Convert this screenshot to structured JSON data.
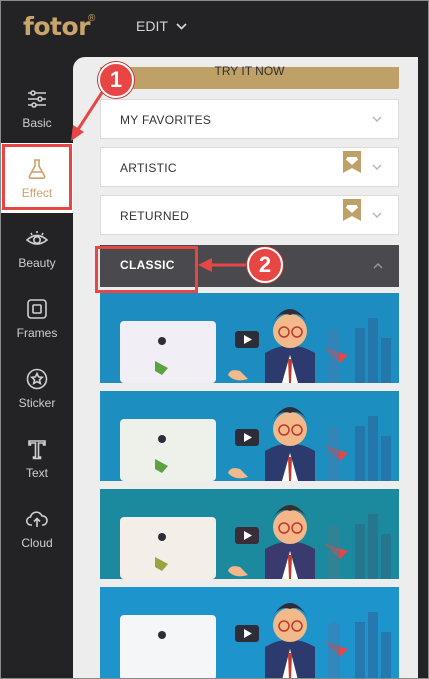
{
  "app": {
    "logo": "fotor",
    "logo_mark": "®",
    "menu_label": "EDIT"
  },
  "sidebar": {
    "items": [
      {
        "label": "Basic",
        "icon": "sliders-icon"
      },
      {
        "label": "Effect",
        "icon": "flask-icon",
        "active": true
      },
      {
        "label": "Beauty",
        "icon": "eye-icon"
      },
      {
        "label": "Frames",
        "icon": "frame-icon"
      },
      {
        "label": "Sticker",
        "icon": "star-badge-icon"
      },
      {
        "label": "Text",
        "icon": "text-t-icon"
      },
      {
        "label": "Cloud",
        "icon": "cloud-upload-icon"
      }
    ]
  },
  "panel": {
    "try_button": "TRY IT NOW",
    "categories": [
      {
        "name": "MY FAVORITES",
        "premium": false,
        "expanded": false
      },
      {
        "name": "ARTISTIC",
        "premium": true,
        "expanded": false
      },
      {
        "name": "RETURNED",
        "premium": true,
        "expanded": false
      },
      {
        "name": "CLASSIC",
        "premium": false,
        "expanded": true
      }
    ],
    "thumbnails": [
      {
        "id": "classic-1"
      },
      {
        "id": "classic-2"
      },
      {
        "id": "classic-3"
      },
      {
        "id": "classic-4"
      }
    ]
  },
  "callouts": [
    {
      "number": "1"
    },
    {
      "number": "2"
    }
  ],
  "colors": {
    "accent_gold": "#c9a46b",
    "callout_red": "#e84545",
    "dark_bg": "#232326"
  }
}
